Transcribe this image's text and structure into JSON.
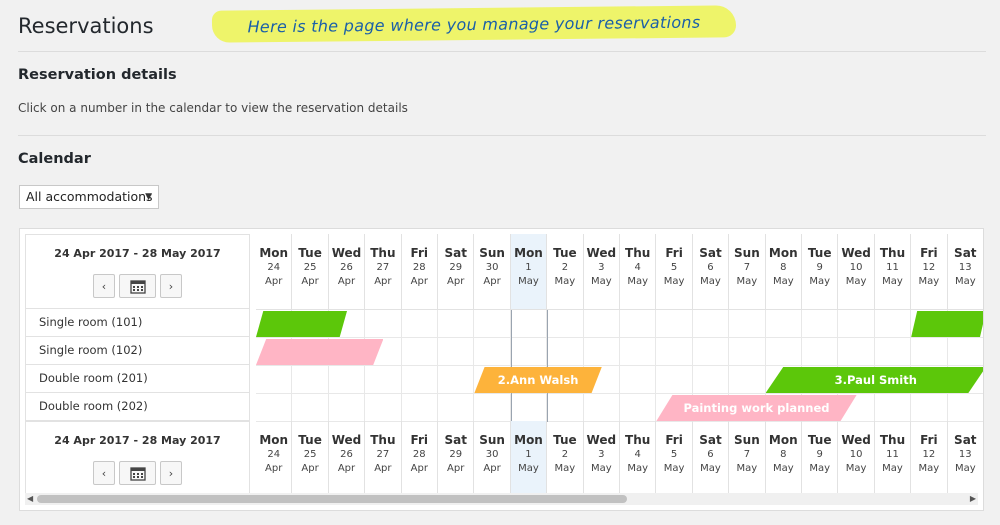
{
  "page": {
    "title": "Reservations",
    "note": "Here is the page where you manage your reservations"
  },
  "details": {
    "heading": "Reservation details",
    "text": "Click on a number in the calendar to view the reservation details"
  },
  "calendar": {
    "heading": "Calendar",
    "filter_value": "All accommodations",
    "range_label": "24 Apr 2017 - 28 May 2017",
    "prev_label": "‹",
    "next_label": "›",
    "days": [
      {
        "dow": "Mon",
        "d": "24",
        "m": "Apr"
      },
      {
        "dow": "Tue",
        "d": "25",
        "m": "Apr"
      },
      {
        "dow": "Wed",
        "d": "26",
        "m": "Apr"
      },
      {
        "dow": "Thu",
        "d": "27",
        "m": "Apr"
      },
      {
        "dow": "Fri",
        "d": "28",
        "m": "Apr"
      },
      {
        "dow": "Sat",
        "d": "29",
        "m": "Apr"
      },
      {
        "dow": "Sun",
        "d": "30",
        "m": "Apr"
      },
      {
        "dow": "Mon",
        "d": "1",
        "m": "May",
        "today": true
      },
      {
        "dow": "Tue",
        "d": "2",
        "m": "May"
      },
      {
        "dow": "Wed",
        "d": "3",
        "m": "May"
      },
      {
        "dow": "Thu",
        "d": "4",
        "m": "May"
      },
      {
        "dow": "Fri",
        "d": "5",
        "m": "May"
      },
      {
        "dow": "Sat",
        "d": "6",
        "m": "May"
      },
      {
        "dow": "Sun",
        "d": "7",
        "m": "May"
      },
      {
        "dow": "Mon",
        "d": "8",
        "m": "May"
      },
      {
        "dow": "Tue",
        "d": "9",
        "m": "May"
      },
      {
        "dow": "Wed",
        "d": "10",
        "m": "May"
      },
      {
        "dow": "Thu",
        "d": "11",
        "m": "May"
      },
      {
        "dow": "Fri",
        "d": "12",
        "m": "May"
      },
      {
        "dow": "Sat",
        "d": "13",
        "m": "May"
      }
    ],
    "rooms": [
      "Single room (101)",
      "Single room (102)",
      "Double room (201)",
      "Double room (202)"
    ],
    "bookings": [
      {
        "row": 0,
        "start": 0,
        "end": 2.5,
        "label": "",
        "color": "#5cc70a"
      },
      {
        "row": 0,
        "start": 18,
        "end": 20.5,
        "label": "",
        "color": "#5cc70a"
      },
      {
        "row": 1,
        "start": 0,
        "end": 3.5,
        "label": "",
        "color": "#ffb5c5"
      },
      {
        "row": 2,
        "start": 6,
        "end": 9.5,
        "label": "2.Ann Walsh",
        "color": "#fdb33b"
      },
      {
        "row": 2,
        "start": 14,
        "end": 20.5,
        "label": "3.Paul Smith",
        "color": "#5cc70a"
      },
      {
        "row": 3,
        "start": 11,
        "end": 16.5,
        "label": "Painting work planned",
        "color": "#ffb5c5"
      }
    ]
  }
}
